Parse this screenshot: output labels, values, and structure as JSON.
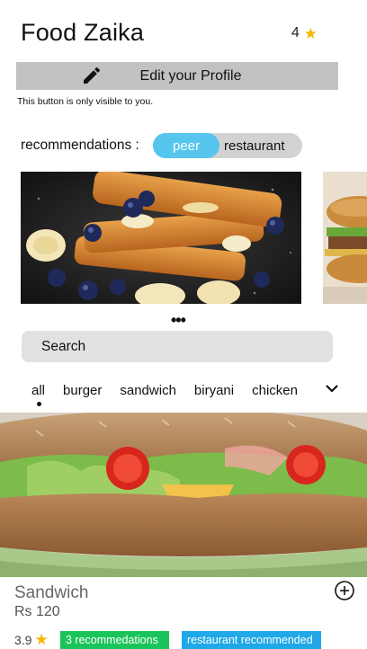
{
  "header": {
    "title": "Food Zaika",
    "rating": "4",
    "rating_icon": "star-icon"
  },
  "profile": {
    "edit_label": "Edit your Profile",
    "edit_icon": "pencil-icon",
    "note": "This button is only visible to you."
  },
  "recommendations": {
    "label": "recommendations :",
    "options": [
      "peer",
      "restaurant"
    ],
    "selected": "peer"
  },
  "carousel": {
    "more_label": "•••"
  },
  "search": {
    "placeholder": "Search"
  },
  "categories": {
    "items": [
      "all",
      "burger",
      "sandwich",
      "biryani",
      "chicken"
    ],
    "selected": "all",
    "expand_icon": "chevron-down-icon"
  },
  "food_item": {
    "name": "Sandwich",
    "price": "Rs 120",
    "rating": "3.9",
    "badge_recommendations": "3 recommedations",
    "badge_restaurant": "restaurant recommended",
    "add_icon": "plus-circle-icon"
  },
  "colors": {
    "accent": "#56c6ef",
    "star": "#f5b800",
    "badge_green": "#1bc45a",
    "badge_blue": "#20a8e8",
    "button_gray": "#c2c2c2",
    "search_gray": "#e1e1e1"
  }
}
